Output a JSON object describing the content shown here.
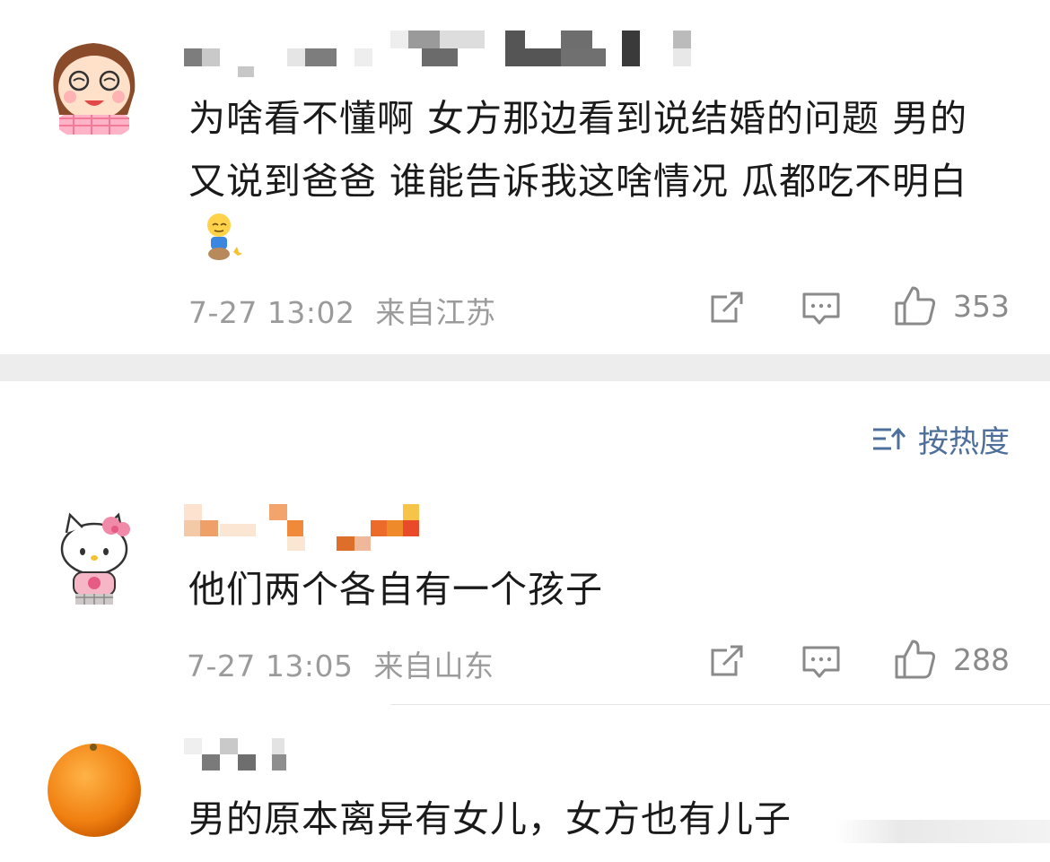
{
  "comments": [
    {
      "text": "为啥看不懂啊 女方那边看到说结婚的问题 男的又说到爸爸  谁能告诉我这啥情况 瓜都吃不明白",
      "time": "7-27 13:02",
      "location": "来自江苏",
      "likes": "353"
    },
    {
      "text": "他们两个各自有一个孩子",
      "time": "7-27 13:05",
      "location": "来自山东",
      "likes": "288"
    },
    {
      "text": "男的原本离异有女儿，女方也有儿子"
    }
  ],
  "sort": {
    "label": "按热度"
  }
}
